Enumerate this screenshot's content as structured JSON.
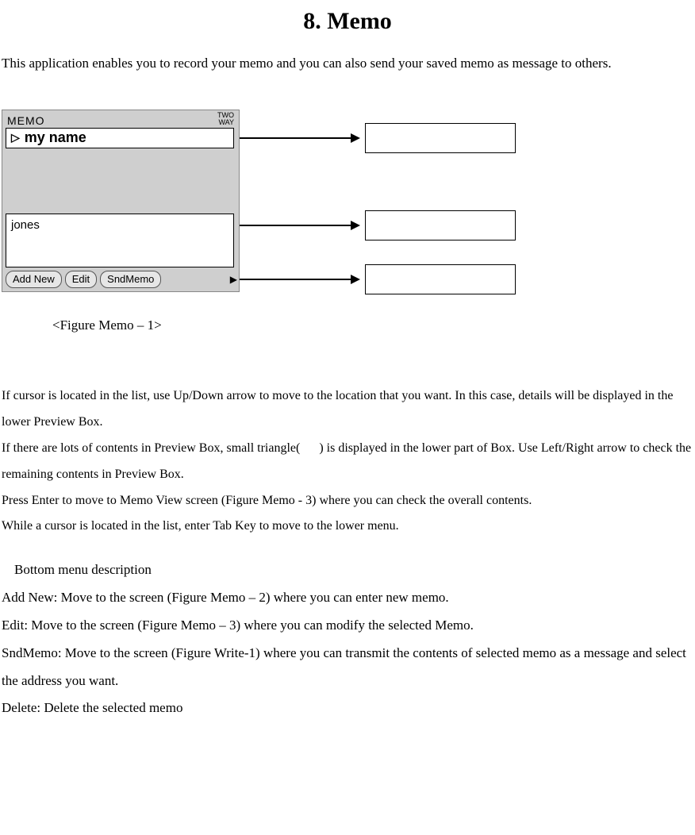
{
  "title": "8. Memo",
  "intro": "This application enables you to record your memo and you can also send your saved memo as message to others.",
  "device": {
    "header": "MEMO",
    "indicator_top": "TWO",
    "indicator_bottom": "WAY",
    "selected_item": "my name",
    "preview_text": "jones",
    "buttons": {
      "add": "Add New",
      "edit": "Edit",
      "send": "SndMemo"
    }
  },
  "figure_caption": "<Figure Memo – 1>",
  "body": {
    "p1": "If cursor is located in the list, use Up/Down arrow to move to the location that you want. In this case, details will be displayed in the lower Preview Box.",
    "p2a": "If there are lots of contents in Preview Box, small triangle(",
    "p2b": ") is displayed in the lower part of Box. Use Left/Right arrow to check the remaining contents in Preview Box.",
    "p3": "Press Enter to move to Memo View screen (Figure Memo - 3) where you can check the overall contents.",
    "p4": "While a cursor is located in the list, enter Tab Key to move to the lower menu."
  },
  "subhead": "Bottom menu description",
  "menu": {
    "addnew": "Add New: Move to the screen (Figure Memo – 2) where you can enter new memo.",
    "edit": "Edit: Move to the screen (Figure Memo – 3) where you can modify the selected Memo.",
    "sndmemo": "SndMemo: Move to the screen (Figure Write-1) where you can transmit the contents of selected memo as a message and select the address you want.",
    "delete": "Delete: Delete the selected memo"
  }
}
